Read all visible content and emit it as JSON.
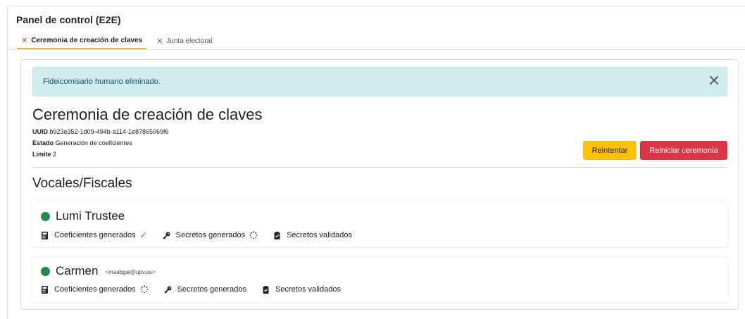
{
  "panel": {
    "title": "Panel de control (E2E)"
  },
  "tabs": [
    {
      "label": "Ceremonia de creación de claves",
      "active": true
    },
    {
      "label": "Junta electoral",
      "active": false
    }
  ],
  "alert": {
    "message": "Fideicomisario humano eliminado."
  },
  "ceremony": {
    "title": "Ceremonia de creación de claves",
    "uuid_label": "UUID",
    "uuid": "b923e352-1d09-494b-a114-1e87865069f6",
    "status_label": "Estado",
    "status": "Generación de coeficientes",
    "limit_label": "Límite",
    "limit": "2",
    "retry_label": "Reintentar",
    "restart_label": "Reiniciar ceremonia"
  },
  "section": {
    "title": "Vocales/Fiscales"
  },
  "trustees": [
    {
      "name": "Lumi Trustee",
      "email": "",
      "status_color": "#1e8a4c",
      "steps": [
        {
          "label": "Coeficientes generados",
          "icon": "calculator-icon",
          "state": "done"
        },
        {
          "label": "Secretos generados",
          "icon": "key-icon",
          "state": "loading"
        },
        {
          "label": "Secretos validados",
          "icon": "clipboard-check-icon",
          "state": "pending"
        }
      ]
    },
    {
      "name": "Carmen",
      "email": "<maabgal@upv.es>",
      "status_color": "#1e8a4c",
      "steps": [
        {
          "label": "Coeficientes generados",
          "icon": "calculator-icon",
          "state": "loading"
        },
        {
          "label": "Secretos generados",
          "icon": "key-icon",
          "state": "pending"
        },
        {
          "label": "Secretos validados",
          "icon": "clipboard-check-icon",
          "state": "pending"
        }
      ]
    }
  ],
  "colors": {
    "accent": "#f0ad4e",
    "danger": "#dc3545",
    "warning": "#ffc107",
    "info_bg": "#d1ecf1",
    "success": "#28a745"
  }
}
